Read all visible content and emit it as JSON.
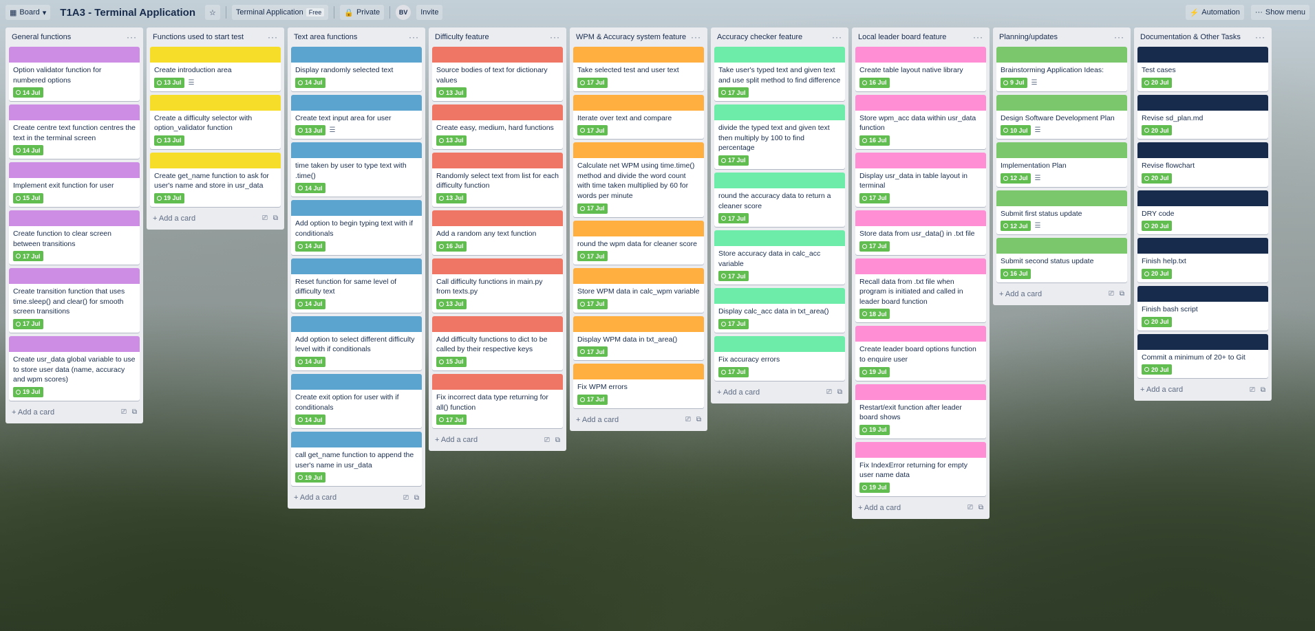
{
  "topbar": {
    "board_switch": "Board",
    "title": "T1A3 - Terminal Application",
    "workspace": "Terminal Application",
    "workspace_badge": "Free",
    "visibility": "Private",
    "avatar": "BV",
    "invite": "Invite",
    "automation": "Automation",
    "show_menu": "Show menu"
  },
  "add_card_label": "+ Add a card",
  "lists": [
    {
      "title": "General functions",
      "color": "#cd8de5",
      "cards": [
        {
          "title": "Option validator function for numbered options",
          "due": "14 Jul"
        },
        {
          "title": "Create centre text function centres the text in the terminal screen",
          "due": "14 Jul"
        },
        {
          "title": "Implement exit function for user",
          "due": "15 Jul"
        },
        {
          "title": "Create function to clear screen between transitions",
          "due": "17 Jul"
        },
        {
          "title": "Create transition function that uses time.sleep() and clear() for smooth screen transitions",
          "due": "17 Jul"
        },
        {
          "title": "Create usr_data global variable to use to store user data (name, accuracy and wpm scores)",
          "due": "19 Jul"
        }
      ]
    },
    {
      "title": "Functions used to start test",
      "color": "#f5dd29",
      "cards": [
        {
          "title": "Create introduction area",
          "due": "13 Jul",
          "desc": true
        },
        {
          "title": "Create a difficulty selector with option_validator function",
          "due": "13 Jul"
        },
        {
          "title": "Create get_name function to ask for user's name and store in usr_data",
          "due": "19 Jul"
        }
      ]
    },
    {
      "title": "Text area functions",
      "color": "#5ba4cf",
      "cards": [
        {
          "title": "Display randomly selected text",
          "due": "14 Jul"
        },
        {
          "title": "Create text input area for user",
          "due": "13 Jul",
          "desc": true
        },
        {
          "title": "time taken by user to type text with .time()",
          "due": "14 Jul"
        },
        {
          "title": "Add option to begin typing text with if conditionals",
          "due": "14 Jul"
        },
        {
          "title": "Reset function for same level of difficulty text",
          "due": "14 Jul"
        },
        {
          "title": "Add option to select different difficulty level with if conditionals",
          "due": "14 Jul"
        },
        {
          "title": "Create exit option for user with if conditionals",
          "due": "14 Jul"
        },
        {
          "title": "call get_name function to append the user's name in usr_data",
          "due": "19 Jul"
        }
      ]
    },
    {
      "title": "Difficulty feature",
      "color": "#ef7564",
      "cards": [
        {
          "title": "Source bodies of text for dictionary values",
          "due": "13 Jul"
        },
        {
          "title": "Create easy, medium, hard functions",
          "due": "13 Jul"
        },
        {
          "title": "Randomly select text from list for each difficulty function",
          "due": "13 Jul"
        },
        {
          "title": "Add a random any text function",
          "due": "16 Jul"
        },
        {
          "title": "Call difficulty functions in main.py from texts.py",
          "due": "13 Jul"
        },
        {
          "title": "Add difficulty functions to dict to be called by their respective keys",
          "due": "15 Jul"
        },
        {
          "title": "Fix incorrect data type returning for all() function",
          "due": "17 Jul"
        }
      ]
    },
    {
      "title": "WPM & Accuracy system feature",
      "color": "#ffaf3f",
      "cards": [
        {
          "title": "Take selected test and user text",
          "due": "17 Jul"
        },
        {
          "title": "Iterate over text and compare",
          "due": "17 Jul"
        },
        {
          "title": "Calculate net WPM using time.time() method and divide the word count with time taken multiplied by 60 for words per minute",
          "due": "17 Jul"
        },
        {
          "title": "round the wpm data for cleaner score",
          "due": "17 Jul"
        },
        {
          "title": "Store WPM data in calc_wpm variable",
          "due": "17 Jul"
        },
        {
          "title": "Display WPM data in txt_area()",
          "due": "17 Jul"
        },
        {
          "title": "Fix WPM errors",
          "due": "17 Jul"
        }
      ]
    },
    {
      "title": "Accuracy checker feature",
      "color": "#6deca9",
      "cards": [
        {
          "title": "Take user's typed text and given text and use split method to find difference",
          "due": "17 Jul"
        },
        {
          "title": "divide the typed text and given text then multiply by 100 to find percentage",
          "due": "17 Jul"
        },
        {
          "title": "round the accuracy data to return a cleaner score",
          "due": "17 Jul"
        },
        {
          "title": "Store accuracy data in calc_acc variable",
          "due": "17 Jul"
        },
        {
          "title": "Display calc_acc data in txt_area()",
          "due": "17 Jul"
        },
        {
          "title": "Fix accuracy errors",
          "due": "17 Jul"
        }
      ]
    },
    {
      "title": "Local leader board feature",
      "color": "#ff8ed4",
      "cards": [
        {
          "title": "Create table layout native library",
          "due": "16 Jul"
        },
        {
          "title": "Store wpm_acc data within usr_data function",
          "due": "16 Jul"
        },
        {
          "title": "Display usr_data in table layout in terminal",
          "due": "17 Jul"
        },
        {
          "title": "Store data from usr_data() in .txt file",
          "due": "17 Jul"
        },
        {
          "title": "Recall data from .txt file when program is initiated and called in leader board function",
          "due": "18 Jul"
        },
        {
          "title": "Create leader board options function to enquire user",
          "due": "19 Jul"
        },
        {
          "title": "Restart/exit function after leader board shows",
          "due": "19 Jul"
        },
        {
          "title": "Fix IndexError returning for empty user name data",
          "due": "19 Jul"
        }
      ]
    },
    {
      "title": "Planning/updates",
      "color": "#7bc86c",
      "cards": [
        {
          "title": "Brainstorming Application Ideas:",
          "due": "9 Jul",
          "desc": true
        },
        {
          "title": "Design Software Development Plan",
          "due": "10 Jul",
          "desc": true
        },
        {
          "title": "Implementation Plan",
          "due": "12 Jul",
          "desc": true
        },
        {
          "title": "Submit first status update",
          "due": "12 Jul",
          "desc": true
        },
        {
          "title": "Submit second status update",
          "due": "16 Jul"
        }
      ]
    },
    {
      "title": "Documentation & Other Tasks",
      "color": "#172b4d",
      "cards": [
        {
          "title": "Test cases",
          "due": "20 Jul"
        },
        {
          "title": "Revise sd_plan.md",
          "due": "20 Jul"
        },
        {
          "title": "Revise flowchart",
          "due": "20 Jul"
        },
        {
          "title": "DRY code",
          "due": "20 Jul"
        },
        {
          "title": "Finish help.txt",
          "due": "20 Jul"
        },
        {
          "title": "Finish bash script",
          "due": "20 Jul"
        },
        {
          "title": "Commit a minimum of 20+ to Git",
          "due": "20 Jul"
        }
      ]
    }
  ]
}
